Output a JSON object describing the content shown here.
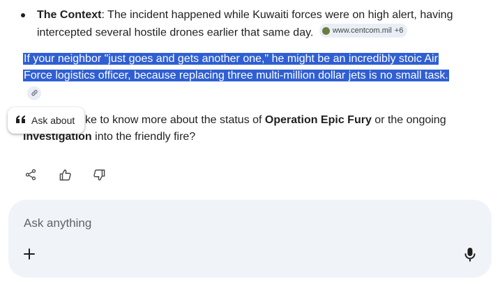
{
  "context_bullet": {
    "label": "The Context",
    "text": ": The incident happened while Kuwaiti forces were on high alert, having intercepted several hostile drones earlier that same day.",
    "source_chip": "www.centcom.mil",
    "source_more": "+6"
  },
  "highlighted_paragraph": {
    "text": "If your neighbor \"just goes and gets another one,\" he might be an incredibly stoic Air Force logistics officer, because replacing three multi-million dollar jets is no small task."
  },
  "followup": {
    "prefix": "ke to know more about the status of ",
    "bold1": "Operation Epic Fury",
    "middle": " or the ongoing ",
    "bold2": "investigation",
    "suffix": " into the friendly fire?"
  },
  "ask_about_popup": {
    "icon": "quote-icon",
    "label": "Ask about"
  },
  "actions": {
    "icons": [
      "share-icon",
      "thumbs-up-icon",
      "thumbs-down-icon"
    ]
  },
  "composer": {
    "placeholder": "Ask anything",
    "icons": [
      "plus-icon",
      "mic-icon"
    ]
  },
  "colors": {
    "selection_bg": "#2f5fd3",
    "composer_bg": "#f0f4f9"
  }
}
